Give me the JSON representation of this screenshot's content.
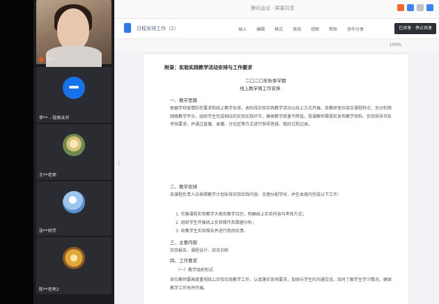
{
  "meeting": {
    "participants": [
      {
        "name": "李**",
        "type": "video"
      },
      {
        "name": "李** - 视频未开",
        "type": "avatar"
      },
      {
        "name": "王**老师",
        "type": "avatar"
      },
      {
        "name": "张**同学",
        "type": "avatar"
      },
      {
        "name": "陈**老师2",
        "type": "avatar"
      }
    ]
  },
  "window": {
    "title": "腾讯会议 · 屏幕共享"
  },
  "toolbar": {
    "doc_name": "日程安排工作（2）",
    "tools": [
      "插入",
      "编辑",
      "格式",
      "审阅",
      "视图",
      "帮助",
      "协作分享"
    ],
    "share_label": "已共享 · 停止共享"
  },
  "subbar": {
    "zoom": "100%"
  },
  "document": {
    "heading": "附录：实验实践教学活动安排与工作要求",
    "subtitle_lines": [
      "二〇二〇年秋季学期",
      "线上教学周工作安排"
    ],
    "sections": [
      {
        "title": "一、教学思路",
        "text": "根据学校疫情防控要求和线上教学安排，本阶段实验实践教学活动以线上方式开展。各教研室应结合课程特点，充分利用网络教学平台，组织学生完成相应的实验实践环节，确保教学质量不降低。授课教师需提前发布教学资料、实验指导书及考核要求，并通过直播、录播、讨论区等方式进行指导答疑，做好过程记录。"
      },
      {
        "title": "二、教学安排",
        "text": "各课程负责人应按照教学计划安排实验实践内容，合理分配学时，并在本周内完成以下工作："
      },
      {
        "title": "三、主要内容",
        "text": "实验报告、课程设计、综合训练"
      },
      {
        "title": "四、工作要求",
        "text": "各位教师要高度重视线上实验实践教学工作，认真落实各项要求，加强与学生的沟通交流，及时了解学生学习情况，确保教学工作有序开展。"
      }
    ],
    "list_items": [
      "1. 完善课程实验教学大纲及教学日历，明确线上实验内容与考核方式；",
      "2. 组织学生开展线上实验操作及数据分析；",
      "3. 收集学生实验报告并进行批改反馈。"
    ],
    "subheading": "（一）教学组织形式"
  }
}
